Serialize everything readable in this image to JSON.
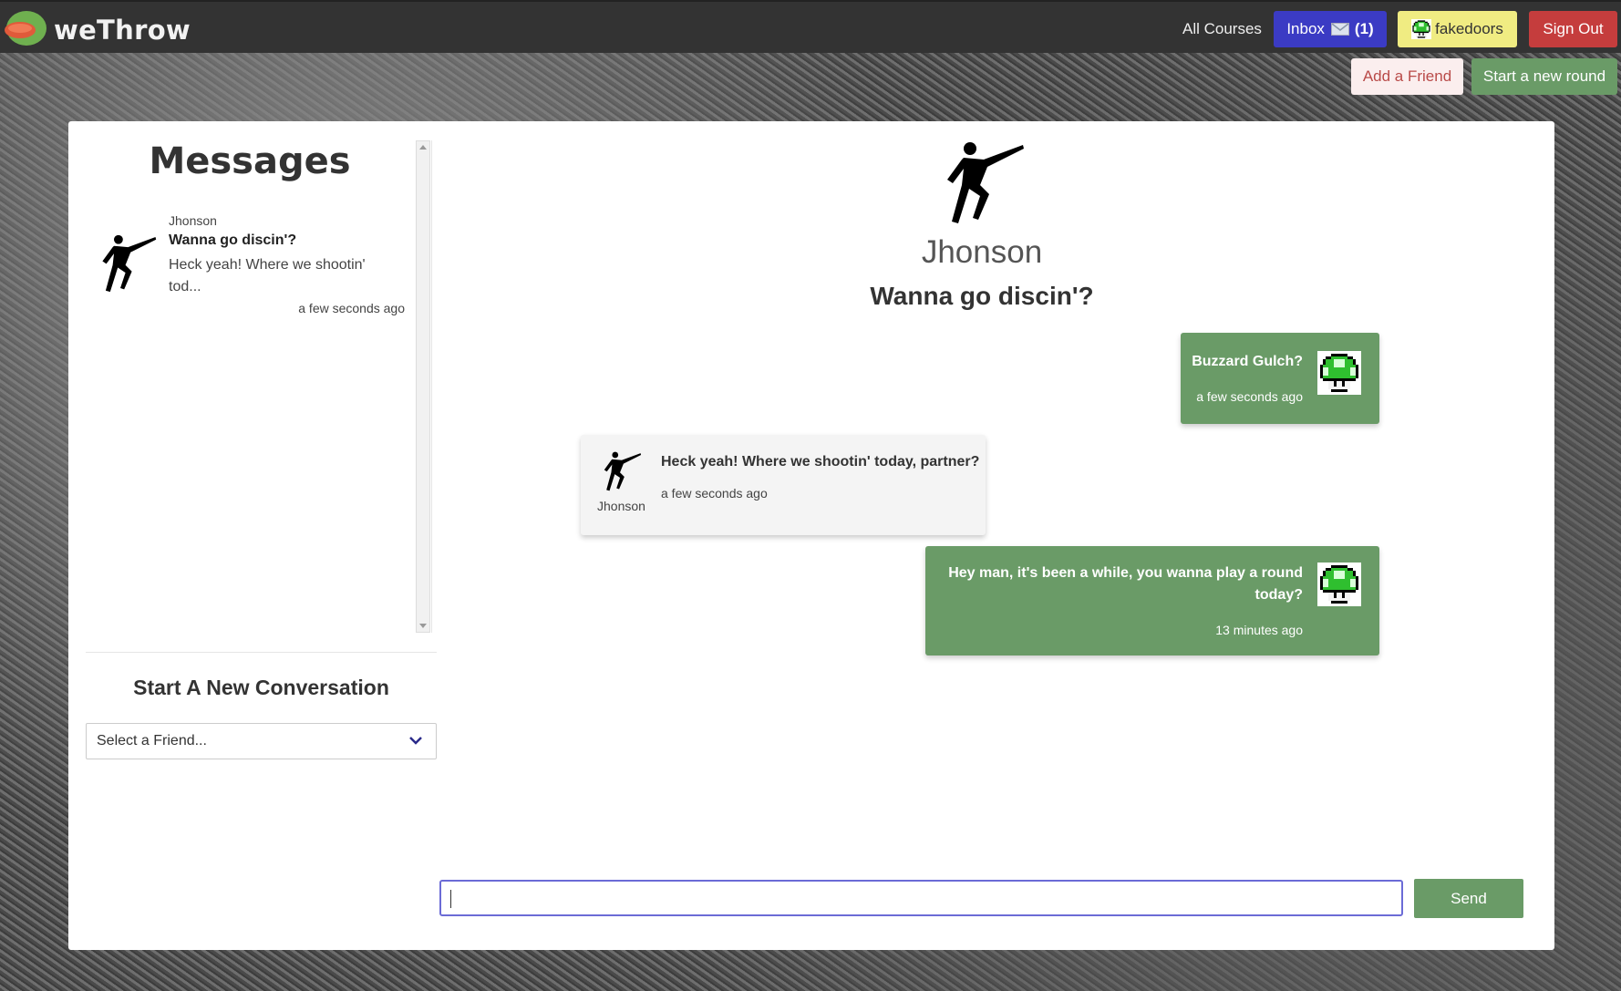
{
  "app": {
    "brand": "weThrow"
  },
  "nav": {
    "all_courses": "All Courses",
    "inbox_label": "Inbox",
    "inbox_count": "(1)",
    "username": "fakedoors",
    "sign_out": "Sign Out"
  },
  "actions": {
    "add_friend": "Add a Friend",
    "new_round": "Start a new round"
  },
  "sidebar": {
    "title": "Messages",
    "conversations": [
      {
        "name": "Jhonson",
        "subject": "Wanna go discin'?",
        "preview": "Heck yeah! Where we shootin' tod...",
        "time": "a few seconds ago"
      }
    ],
    "new_conversation_title": "Start A New Conversation",
    "friend_select_placeholder": "Select a Friend..."
  },
  "conversation": {
    "partner_name": "Jhonson",
    "subject": "Wanna go discin'?",
    "messages": [
      {
        "from": "me",
        "text": "Buzzard Gulch?",
        "time": "a few seconds ago"
      },
      {
        "from": "Jhonson",
        "sender_label": "Jhonson",
        "text": "Heck yeah! Where we shootin' today, partner?",
        "time": "a few seconds ago"
      },
      {
        "from": "me",
        "text": "Hey man, it's been a while, you wanna play a round today?",
        "time": "13 minutes ago"
      }
    ]
  },
  "composer": {
    "value": "",
    "send_label": "Send"
  },
  "colors": {
    "navbar": "#333333",
    "inbox": "#3b3bc4",
    "user": "#f0ec82",
    "sign_out": "#c53d3d",
    "green": "#6a9b67",
    "add_friend_text": "#b94a48"
  },
  "icons": {
    "brand": "disc-golf-logo-icon",
    "avatar_partner": "disc-thrower-icon",
    "avatar_me": "green-mushroom-icon"
  }
}
